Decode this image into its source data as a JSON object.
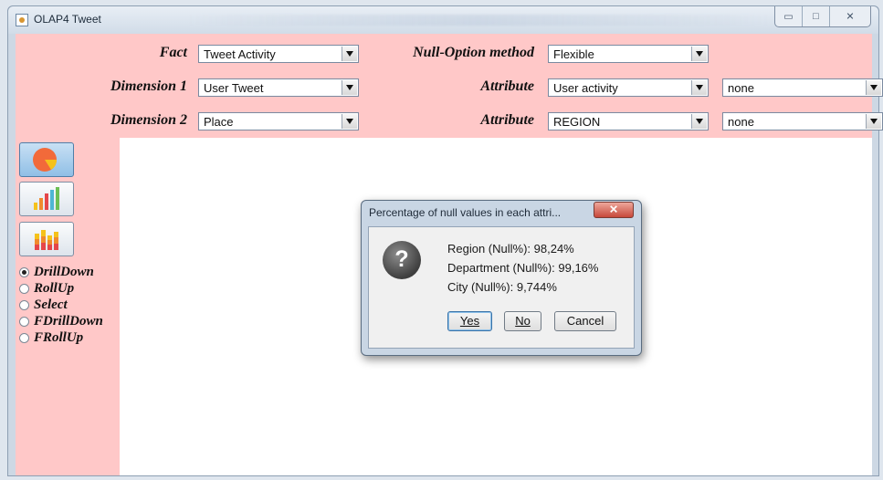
{
  "window": {
    "title": "OLAP4 Tweet"
  },
  "form": {
    "fact_label": "Fact",
    "fact_value": "Tweet Activity",
    "null_label": "Null-Option method",
    "null_value": "Flexible",
    "dim1_label": "Dimension 1",
    "dim1_value": "User Tweet",
    "attr1_label": "Attribute",
    "attr1_value": "User activity",
    "attr1_extra": "none",
    "dim2_label": "Dimension 2",
    "dim2_value": "Place",
    "attr2_label": "Attribute",
    "attr2_value": "REGION",
    "attr2_extra": "none"
  },
  "toolbar": {
    "buttons": [
      "pie-chart-icon",
      "bar-chart-icon",
      "stacked-bar-chart-icon"
    ],
    "active_index": 0
  },
  "operations": [
    {
      "label": "DrillDown",
      "selected": true
    },
    {
      "label": "RollUp",
      "selected": false
    },
    {
      "label": "Select",
      "selected": false
    },
    {
      "label": "FDrillDown",
      "selected": false
    },
    {
      "label": "FRollUp",
      "selected": false
    }
  ],
  "dialog": {
    "title": "Percentage of null values in each attri...",
    "lines": [
      "Region (Null%): 98,24%",
      "Department (Null%): 99,16%",
      "City (Null%): 9,744%"
    ],
    "buttons": {
      "yes": "Yes",
      "no": "No",
      "cancel": "Cancel"
    },
    "icon": "question-icon"
  },
  "colors": {
    "panel": "#ffc8c8",
    "pie_orange": "#f26a3a",
    "pie_yellow": "#f5c21b"
  }
}
